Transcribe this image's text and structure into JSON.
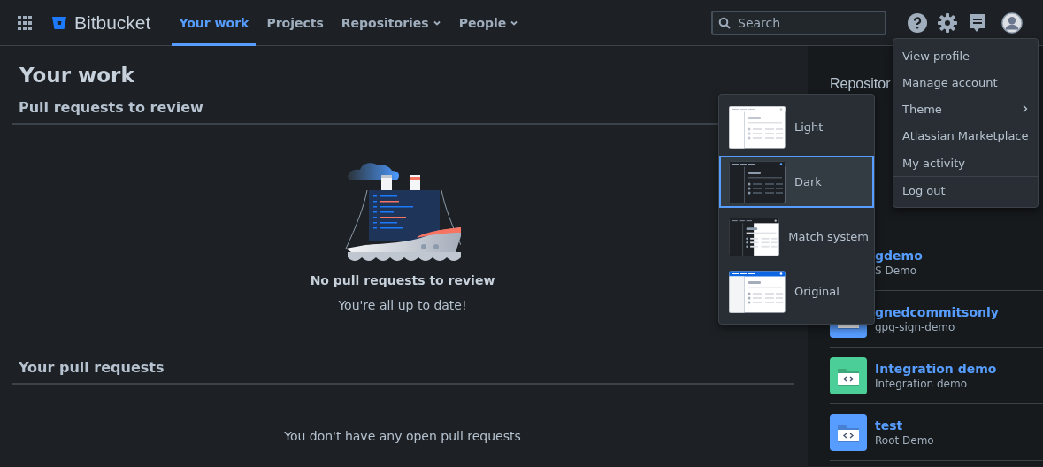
{
  "header": {
    "brand": "Bitbucket",
    "nav": [
      {
        "label": "Your work",
        "selected": true,
        "has_menu": false
      },
      {
        "label": "Projects",
        "selected": false,
        "has_menu": false
      },
      {
        "label": "Repositories",
        "selected": false,
        "has_menu": true
      },
      {
        "label": "People",
        "selected": false,
        "has_menu": true
      }
    ],
    "search": {
      "placeholder": "Search"
    }
  },
  "main": {
    "title": "Your work",
    "sections": [
      {
        "title": "Pull requests to review",
        "empty_title": "No pull requests to review",
        "empty_text": "You're all up to date!",
        "illustration": true
      },
      {
        "title": "Your pull requests",
        "empty_text": "You don't have any open pull requests",
        "illustration": false
      }
    ]
  },
  "repositories": {
    "title": "Repositor",
    "items": [
      {
        "name": "gdemo",
        "subtitle": "S Demo"
      },
      {
        "name": "gnedcommitsonly",
        "subtitle": "gpg-sign-demo",
        "color": "#579dff"
      },
      {
        "name": "Integration demo",
        "subtitle": "Integration demo",
        "color": "#4bce97"
      },
      {
        "name": "test",
        "subtitle": "Root Demo",
        "color": "#579dff"
      }
    ]
  },
  "profile_menu": {
    "groups": [
      [
        {
          "label": "View profile",
          "has_submenu": false
        },
        {
          "label": "Manage account",
          "has_submenu": false
        },
        {
          "label": "Theme",
          "has_submenu": true
        },
        {
          "label": "Atlassian Marketplace",
          "has_submenu": false
        }
      ],
      [
        {
          "label": "My activity",
          "has_submenu": false
        }
      ],
      [
        {
          "label": "Log out",
          "has_submenu": false
        }
      ]
    ]
  },
  "theme_menu": [
    {
      "label": "Light",
      "kind": "light",
      "selected": false
    },
    {
      "label": "Dark",
      "kind": "dark",
      "selected": true
    },
    {
      "label": "Match system",
      "kind": "system",
      "selected": false
    },
    {
      "label": "Original",
      "kind": "original",
      "selected": false
    }
  ]
}
